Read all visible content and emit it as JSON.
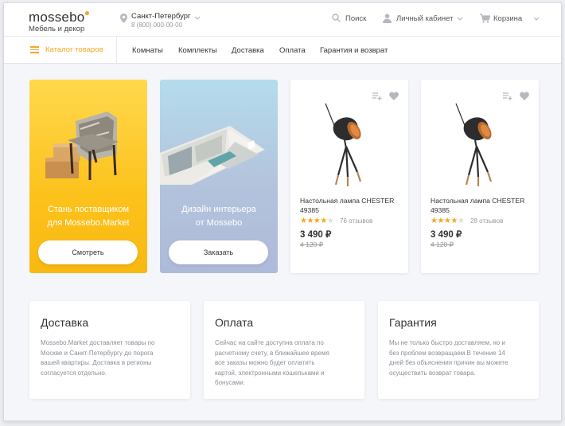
{
  "header": {
    "logo": {
      "word": "mossebo",
      "subtitle": "Мебель и декор"
    },
    "city": {
      "name": "Санкт-Петербург",
      "phone": "8 (800) 000-00-00"
    },
    "search_label": "Поиск",
    "account_label": "Личный кабинет",
    "cart_label": "Корзина"
  },
  "nav": {
    "catalog_label": "Каталог товаров",
    "links": [
      "Комнаты",
      "Комплекты",
      "Доставка",
      "Оплата",
      "Гарантия и возврат"
    ]
  },
  "promos": [
    {
      "title_lines": [
        "Стань поставщиком",
        "для Mossebo.Market"
      ],
      "button": "Смотреть"
    },
    {
      "title_lines": [
        "Дизайн интерьера",
        "от Mossebo"
      ],
      "button": "Заказать"
    }
  ],
  "products": [
    {
      "name": "Настольная лампа CHESTER 49385",
      "rating": 4,
      "reviews": "76 отзывов",
      "price": "3 490 ₽",
      "old_price": "4 120 ₽"
    },
    {
      "name": "Настольная лампа CHESTER 49385",
      "rating": 4,
      "reviews": "28 отзывов",
      "price": "3 490 ₽",
      "old_price": "4 120 ₽"
    }
  ],
  "info": [
    {
      "title": "Доставка",
      "lines": [
        "Mossebo.Market доставляет товары по",
        "Москве и Санкт-Петербургу до порога",
        "вашей квартиры. Доставка в регионы",
        "согласуется отдельно."
      ]
    },
    {
      "title": "Оплата",
      "lines": [
        "Сейчас на сайте доступна оплата по",
        "расчетному счету, в ближайшее время",
        "все заказы можно будет оплатить",
        "картой, электронными кошельками и",
        "бонусами."
      ]
    },
    {
      "title": "Гарантия",
      "lines": [
        "Мы не только быстро доставляем, но и",
        "без проблем возвращаем.В течение 14",
        "дней без объяснения причин вы можете",
        "осуществить возврат товара."
      ]
    }
  ],
  "colors": {
    "accent": "#f5a623",
    "star_on": "#f5a623",
    "star_off": "#dddddd"
  }
}
